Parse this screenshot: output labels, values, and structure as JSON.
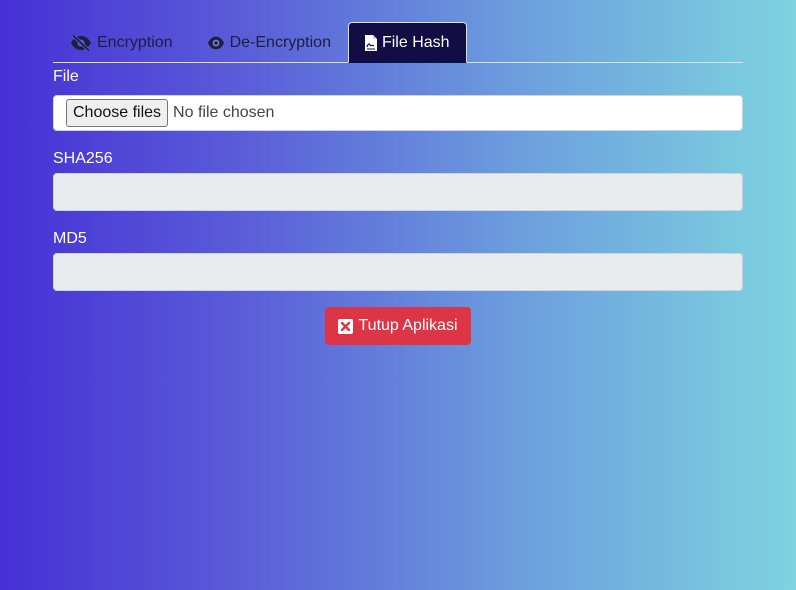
{
  "tabs": [
    {
      "label": "Encryption",
      "icon": "eye-slash-icon",
      "active": false
    },
    {
      "label": "De-Encryption",
      "icon": "eye-icon",
      "active": false
    },
    {
      "label": "File Hash",
      "icon": "file-signature-icon",
      "active": true
    }
  ],
  "file_field": {
    "label": "File",
    "button_label": "Choose files",
    "status": "No file chosen"
  },
  "sha256_field": {
    "label": "SHA256",
    "value": ""
  },
  "md5_field": {
    "label": "MD5",
    "value": ""
  },
  "close_button": {
    "label": "Tutup Aplikasi",
    "icon": "x-square-icon",
    "color": "#dc3545"
  },
  "colors": {
    "gradient_start": "#4630d6",
    "gradient_end": "#7ed4df",
    "active_tab": "#120d42"
  }
}
